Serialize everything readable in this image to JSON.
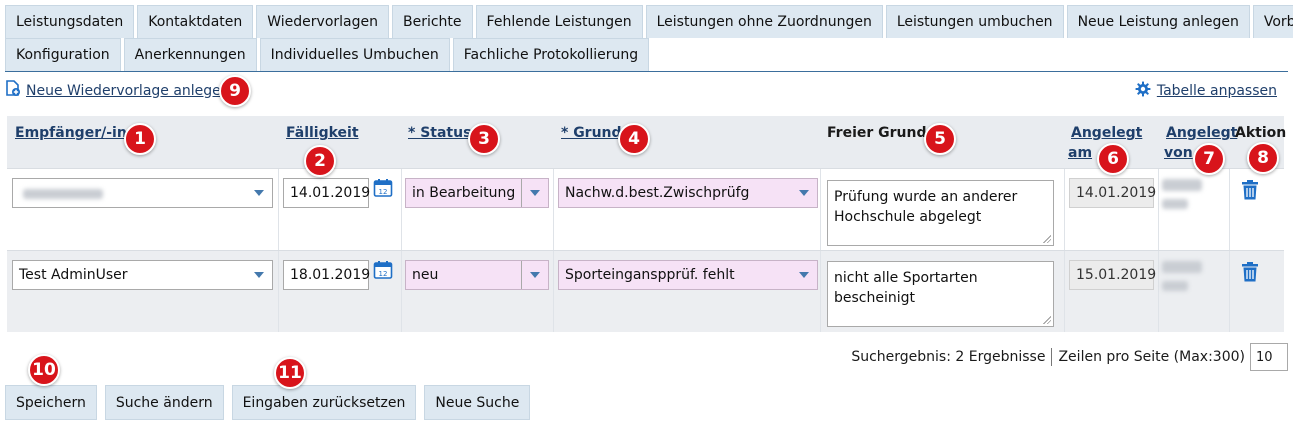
{
  "tabs_row1": [
    "Leistungsdaten",
    "Kontaktdaten",
    "Wiedervorlagen",
    "Berichte",
    "Fehlende Leistungen",
    "Leistungen ohne Zuordnungen",
    "Leistungen umbuchen",
    "Neue Leistung anlegen",
    "Vorbehalte"
  ],
  "tabs_row2": [
    "Konfiguration",
    "Anerkennungen",
    "Individuelles Umbuchen",
    "Fachliche Protokollierung"
  ],
  "actions": {
    "new_reminder": "Neue Wiedervorlage anlegen",
    "adjust_table": "Tabelle anpassen"
  },
  "columns": {
    "recipient": "Empfänger/-in",
    "due": "Fälligkeit",
    "status": "* Status",
    "reason": "* Grund",
    "free_reason": "Freier Grund",
    "created_on_1": "Angelegt",
    "created_on_2": "am",
    "created_by_1": "Angelegt",
    "created_by_2": "von",
    "action": "Aktion"
  },
  "rows": [
    {
      "recipient": "",
      "due": "14.01.2019",
      "status": "in Bearbeitung",
      "reason": "Nachw.d.best.Zwischprüfg",
      "free_reason_1": "Prüfung wurde an anderer",
      "free_reason_2": "Hochschule abgelegt",
      "created_on": "14.01.2019"
    },
    {
      "recipient": "Test AdminUser",
      "due": "18.01.2019",
      "status": "neu",
      "reason": "Sporteinganspprüf. fehlt",
      "free_reason_1": "nicht alle Sportarten bescheinigt",
      "free_reason_2": "",
      "created_on": "15.01.2019"
    }
  ],
  "pager": {
    "results": "Suchergebnis: 2 Ergebnisse",
    "rows_per_page": "Zeilen pro Seite (Max:300)",
    "page_size": "10"
  },
  "buttons": {
    "save": "Speichern",
    "change_search": "Suche ändern",
    "reset": "Eingaben zurücksetzen",
    "new_search": "Neue Suche"
  },
  "markers": [
    "1",
    "2",
    "3",
    "4",
    "5",
    "6",
    "7",
    "8",
    "9",
    "10",
    "11"
  ],
  "colors": {
    "tab_bg": "#dde8f1",
    "link": "#1f3f6b",
    "marker": "#d8141b",
    "required_field": "#f6e2f6",
    "icon_blue": "#1f6fc6"
  }
}
